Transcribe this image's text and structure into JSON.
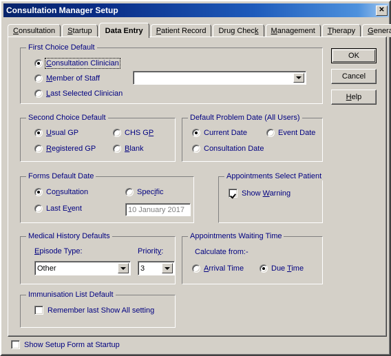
{
  "window": {
    "title": "Consultation Manager Setup",
    "close_label": "✕"
  },
  "tabs": [
    {
      "label": "Consultation",
      "accel_index": 0,
      "active": false
    },
    {
      "label": "Startup",
      "accel_index": 0,
      "active": false
    },
    {
      "label": "Data Entry",
      "accel_index": -1,
      "active": true
    },
    {
      "label": "Patient Record",
      "accel_index": 0,
      "active": false
    },
    {
      "label": "Drug Check",
      "accel_index": 9,
      "active": false
    },
    {
      "label": "Management",
      "accel_index": 0,
      "active": false
    },
    {
      "label": "Therapy",
      "accel_index": 0,
      "active": false
    },
    {
      "label": "General",
      "accel_index": 0,
      "active": false
    }
  ],
  "buttons": {
    "ok": "OK",
    "cancel": "Cancel",
    "help": "Help"
  },
  "groups": {
    "first_choice": {
      "title": "First Choice Default",
      "options": [
        {
          "label": "Consultation Clinician",
          "selected": true,
          "focused": true
        },
        {
          "label": "Member of Staff",
          "selected": false,
          "focused": false
        },
        {
          "label": "Last Selected Clinician",
          "selected": false,
          "focused": false
        }
      ],
      "staff_combo_value": ""
    },
    "second_choice": {
      "title": "Second Choice Default",
      "options": [
        {
          "label": "Usual GP",
          "selected": true
        },
        {
          "label": "CHS GP",
          "selected": false
        },
        {
          "label": "Registered GP",
          "selected": false
        },
        {
          "label": "Blank",
          "selected": false
        }
      ]
    },
    "problem_date": {
      "title": "Default Problem Date (All Users)",
      "options": [
        {
          "label": "Current Date",
          "selected": true
        },
        {
          "label": "Event Date",
          "selected": false
        },
        {
          "label": "Consultation Date",
          "selected": false
        }
      ]
    },
    "forms_default_date": {
      "title": "Forms Default Date",
      "options": [
        {
          "label": "Consultation",
          "selected": true
        },
        {
          "label": "Specific",
          "selected": false
        },
        {
          "label": "Last Event",
          "selected": false
        }
      ],
      "specific_date_value": "10 January 2017"
    },
    "appointments_select_patient": {
      "title": "Appointments Select Patient",
      "show_warning_label": "Show Warning",
      "show_warning_checked": true
    },
    "medical_history": {
      "title": "Medical History Defaults",
      "episode_type_label": "Episode Type:",
      "episode_type_value": "Other",
      "priority_label": "Priority:",
      "priority_value": "3"
    },
    "waiting_time": {
      "title": "Appointments Waiting Time",
      "calculate_from_label": "Calculate from:-",
      "options": [
        {
          "label": "Arrival Time",
          "selected": false
        },
        {
          "label": "Due Time",
          "selected": true
        }
      ]
    },
    "immunisation": {
      "title": "Immunisation List Default",
      "remember_label": "Remember last Show All setting",
      "remember_checked": false
    }
  },
  "footer": {
    "show_setup_label": "Show Setup Form at Startup",
    "show_setup_checked": false
  },
  "colors": {
    "face": "#d4d0c8",
    "label_blue": "#000080",
    "title_left": "#08246b",
    "title_right": "#a6caf0"
  }
}
